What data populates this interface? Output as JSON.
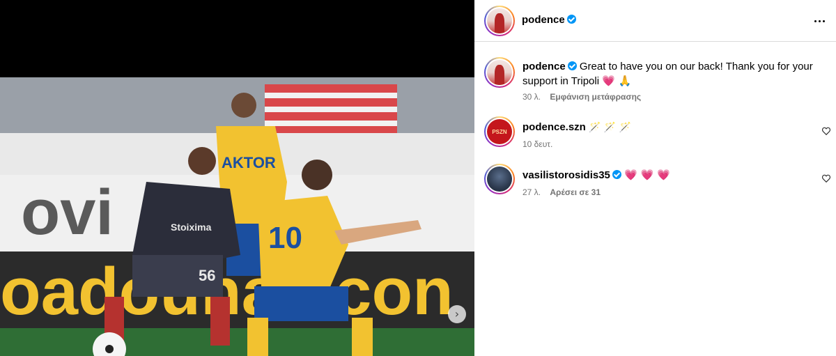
{
  "post": {
    "author": "podence",
    "author_verified": true
  },
  "caption": {
    "username": "podence",
    "text": "Great to have you on our back! Thank you for your support in Tripoli",
    "emojis": "💗 🙏",
    "time": "30 λ.",
    "translate_label": "Εμφάνιση μετάφρασης"
  },
  "comments": [
    {
      "username": "podence.szn",
      "text": "🪄 🪄 🪄",
      "time": "10 δευτ.",
      "likes_label": "",
      "verified": false
    },
    {
      "username": "vasilistorosidis35",
      "text": "💗 💗 💗",
      "time": "27 λ.",
      "likes_label": "Αρέσει σε 31",
      "verified": true
    }
  ],
  "icons": {
    "more": "more-options-icon",
    "next": "chevron-right-icon",
    "like": "heart-outline-icon",
    "verified": "verified-badge-icon"
  },
  "colors": {
    "verified": "#0095f6",
    "muted_text": "#737373",
    "heart": "#ff3040",
    "jersey_red": "#2b2d3a",
    "jersey_yellow": "#f2c230",
    "jersey_blue": "#1b4fa0"
  }
}
